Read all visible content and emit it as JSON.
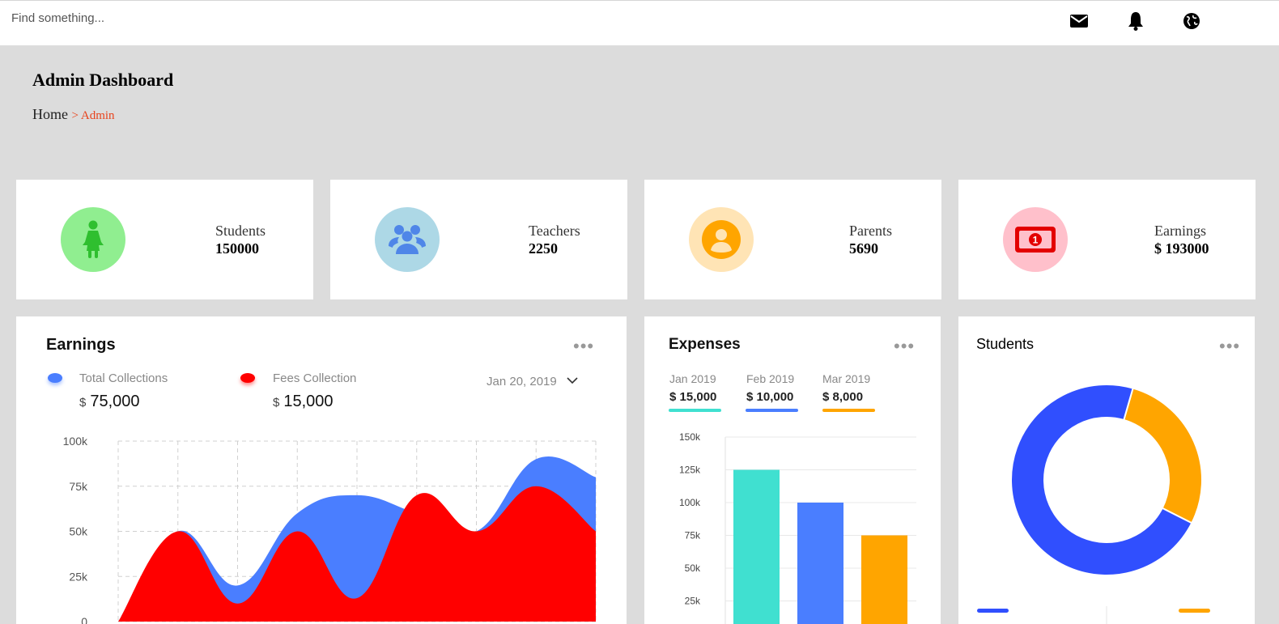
{
  "search": {
    "placeholder": "Find something..."
  },
  "topbar": {
    "icons": [
      "envelope-icon",
      "bell-icon",
      "globe-icon"
    ]
  },
  "header": {
    "title": "Admin Dashboard",
    "breadcrumb_home": "Home",
    "breadcrumb_current": "> Admin"
  },
  "stats": [
    {
      "label": "Students",
      "value": "150000",
      "icon": "student-icon",
      "color": "#90ee90",
      "icon_color": "#2fbf2f"
    },
    {
      "label": "Teachers",
      "value": "2250",
      "icon": "teachers-icon",
      "color": "#add8e6",
      "icon_color": "#4f86e8"
    },
    {
      "label": "Parents",
      "value": "5690",
      "icon": "parent-icon",
      "color": "#ffe4b5",
      "icon_color": "#ffa500"
    },
    {
      "label": "Earnings",
      "value": "$ 193000",
      "icon": "money-icon",
      "color": "#ffc0cb",
      "icon_color": "#e30000"
    }
  ],
  "earnings": {
    "title": "Earnings",
    "total_label": "Total Collections",
    "total_currency": "$",
    "total_value": "75,000",
    "fees_label": "Fees Collection",
    "fees_currency": "$",
    "fees_value": "15,000",
    "date": "Jan 20, 2019",
    "colors": {
      "total": "#4a7eff",
      "fees": "#ff0000"
    }
  },
  "expenses": {
    "title": "Expenses",
    "months": [
      {
        "month": "Jan 2019",
        "amount": "$ 15,000",
        "color": "#40e0d0"
      },
      {
        "month": "Feb 2019",
        "amount": "$ 10,000",
        "color": "#4a7eff"
      },
      {
        "month": "Mar 2019",
        "amount": "$ 8,000",
        "color": "#ffa500"
      }
    ]
  },
  "students_panel": {
    "title": "Students"
  },
  "chart_data": [
    {
      "type": "area",
      "ylim": [
        0,
        100000
      ],
      "y_ticks": [
        0,
        25000,
        50000,
        75000,
        100000
      ],
      "y_tick_labels": [
        "0",
        "25k",
        "50k",
        "75k",
        "100k"
      ],
      "x": [
        0,
        1,
        2,
        3,
        4,
        5,
        6,
        7,
        8
      ],
      "grid": true,
      "series": [
        {
          "values": [
            0,
            50000,
            20000,
            60000,
            70000,
            60000,
            50000,
            90000,
            80000
          ],
          "color": "#4a7eff"
        },
        {
          "values": [
            0,
            50000,
            10000,
            50000,
            13000,
            70000,
            50000,
            75000,
            50000
          ],
          "color": "#ff0000"
        }
      ]
    },
    {
      "type": "bar",
      "ylim": [
        0,
        150000
      ],
      "y_ticks": [
        25000,
        50000,
        75000,
        100000,
        125000,
        150000
      ],
      "y_tick_labels": [
        "25k",
        "50k",
        "75k",
        "100k",
        "125k",
        "150k"
      ],
      "values": [
        125000,
        100000,
        75000
      ],
      "colors": [
        "#40e0d0",
        "#4a7eff",
        "#ffa500"
      ]
    },
    {
      "type": "pie",
      "donut": true,
      "values": [
        28,
        72
      ],
      "colors": [
        "#304ffe",
        "#ffa500"
      ]
    }
  ]
}
